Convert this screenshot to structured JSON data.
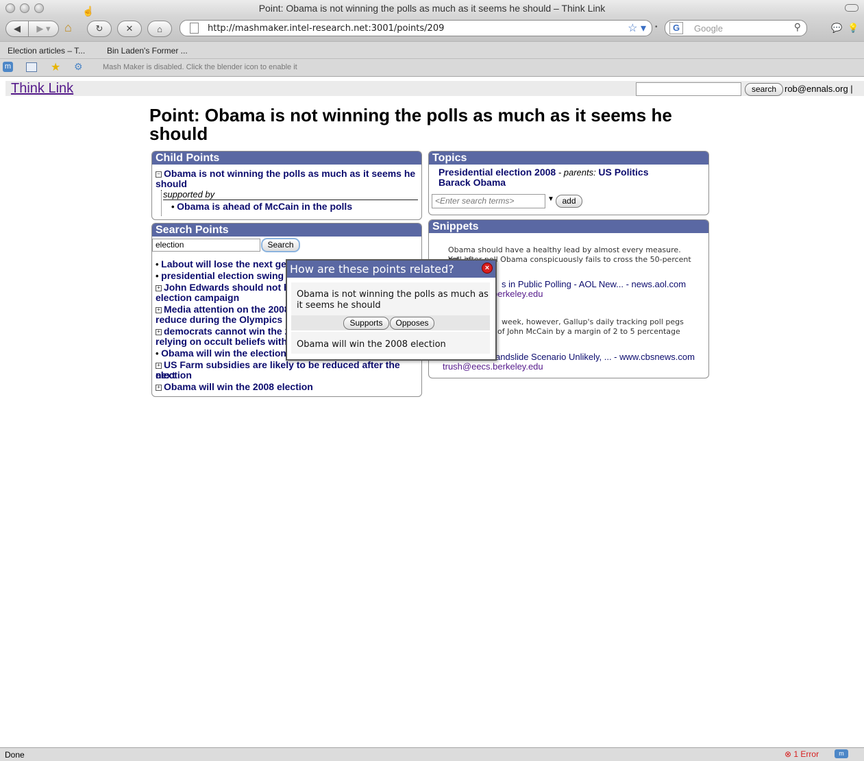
{
  "window": {
    "title": "Point: Obama is not winning the polls as much as it seems he should – Think Link"
  },
  "navbar": {
    "url": "http://mashmaker.intel-research.net:3001/points/209",
    "search_placeholder": "Google"
  },
  "bookmarks": [
    "Election articles – T...",
    "Bin Laden's Former ..."
  ],
  "mashbar": {
    "message": "Mash Maker is disabled. Click the blender icon to enable it"
  },
  "site": {
    "logo": "Think Link",
    "search_button": "search",
    "user": "rob@ennals.org |"
  },
  "page": {
    "title": "Point: Obama is not winning the polls as much as it seems he should"
  },
  "child_points": {
    "header": "Child Points",
    "point": "Obama is not winning the polls as much as it seems he should",
    "relation": "supported by",
    "child": "Obama is ahead of McCain in the polls"
  },
  "search_points": {
    "header": "Search Points",
    "query": "election",
    "button": "Search",
    "items": [
      "Labout will lose the next ger",
      "presidential election swing s",
      "John Edwards should not ha",
      "election campaign",
      "Media attention on the 2008",
      "reduce during the Olympics",
      "democrats cannot win the 20",
      "relying on occult beliefs witho",
      "Obama will win the election",
      "US Farm subsidies are likely to be reduced after the next",
      "election",
      "Obama will win the 2008 election"
    ]
  },
  "topics": {
    "header": "Topics",
    "topic1": "Presidential election 2008",
    "parents_label": "- parents:",
    "parent": "US Politics",
    "topic2": "Barack Obama",
    "search_placeholder": "<Enter search terms>",
    "add_button": "add"
  },
  "snippets": {
    "header": "Snippets",
    "s1_line1": "Obama should have a healthy lead by almost every measure. Yet, in",
    "s1_line2": "Obama conspicuously fails to cross the 50-percent",
    "s1_line2_left": "poll after poll",
    "s1_link": "s in Public Polling - AOL New... - news.aol.com",
    "s1_user": "berkeley.edu",
    "s2_line1": "week, however, Gallup's daily tracking poll pegs",
    "s2_line2": "of John McCain by a margin of 2 to 5 percentage",
    "s2_link": "andslide Scenario Unlikely, ... - www.cbsnews.com",
    "s2_user": "trush@eecs.berkeley.edu"
  },
  "dialog": {
    "title": "How are these points related?",
    "point_a": "Obama is not winning the polls as much as it seems he should",
    "supports": "Supports",
    "opposes": "Opposes",
    "point_b": "Obama will win the 2008 election"
  },
  "status": {
    "text": "Done",
    "errors": "1 Error"
  }
}
